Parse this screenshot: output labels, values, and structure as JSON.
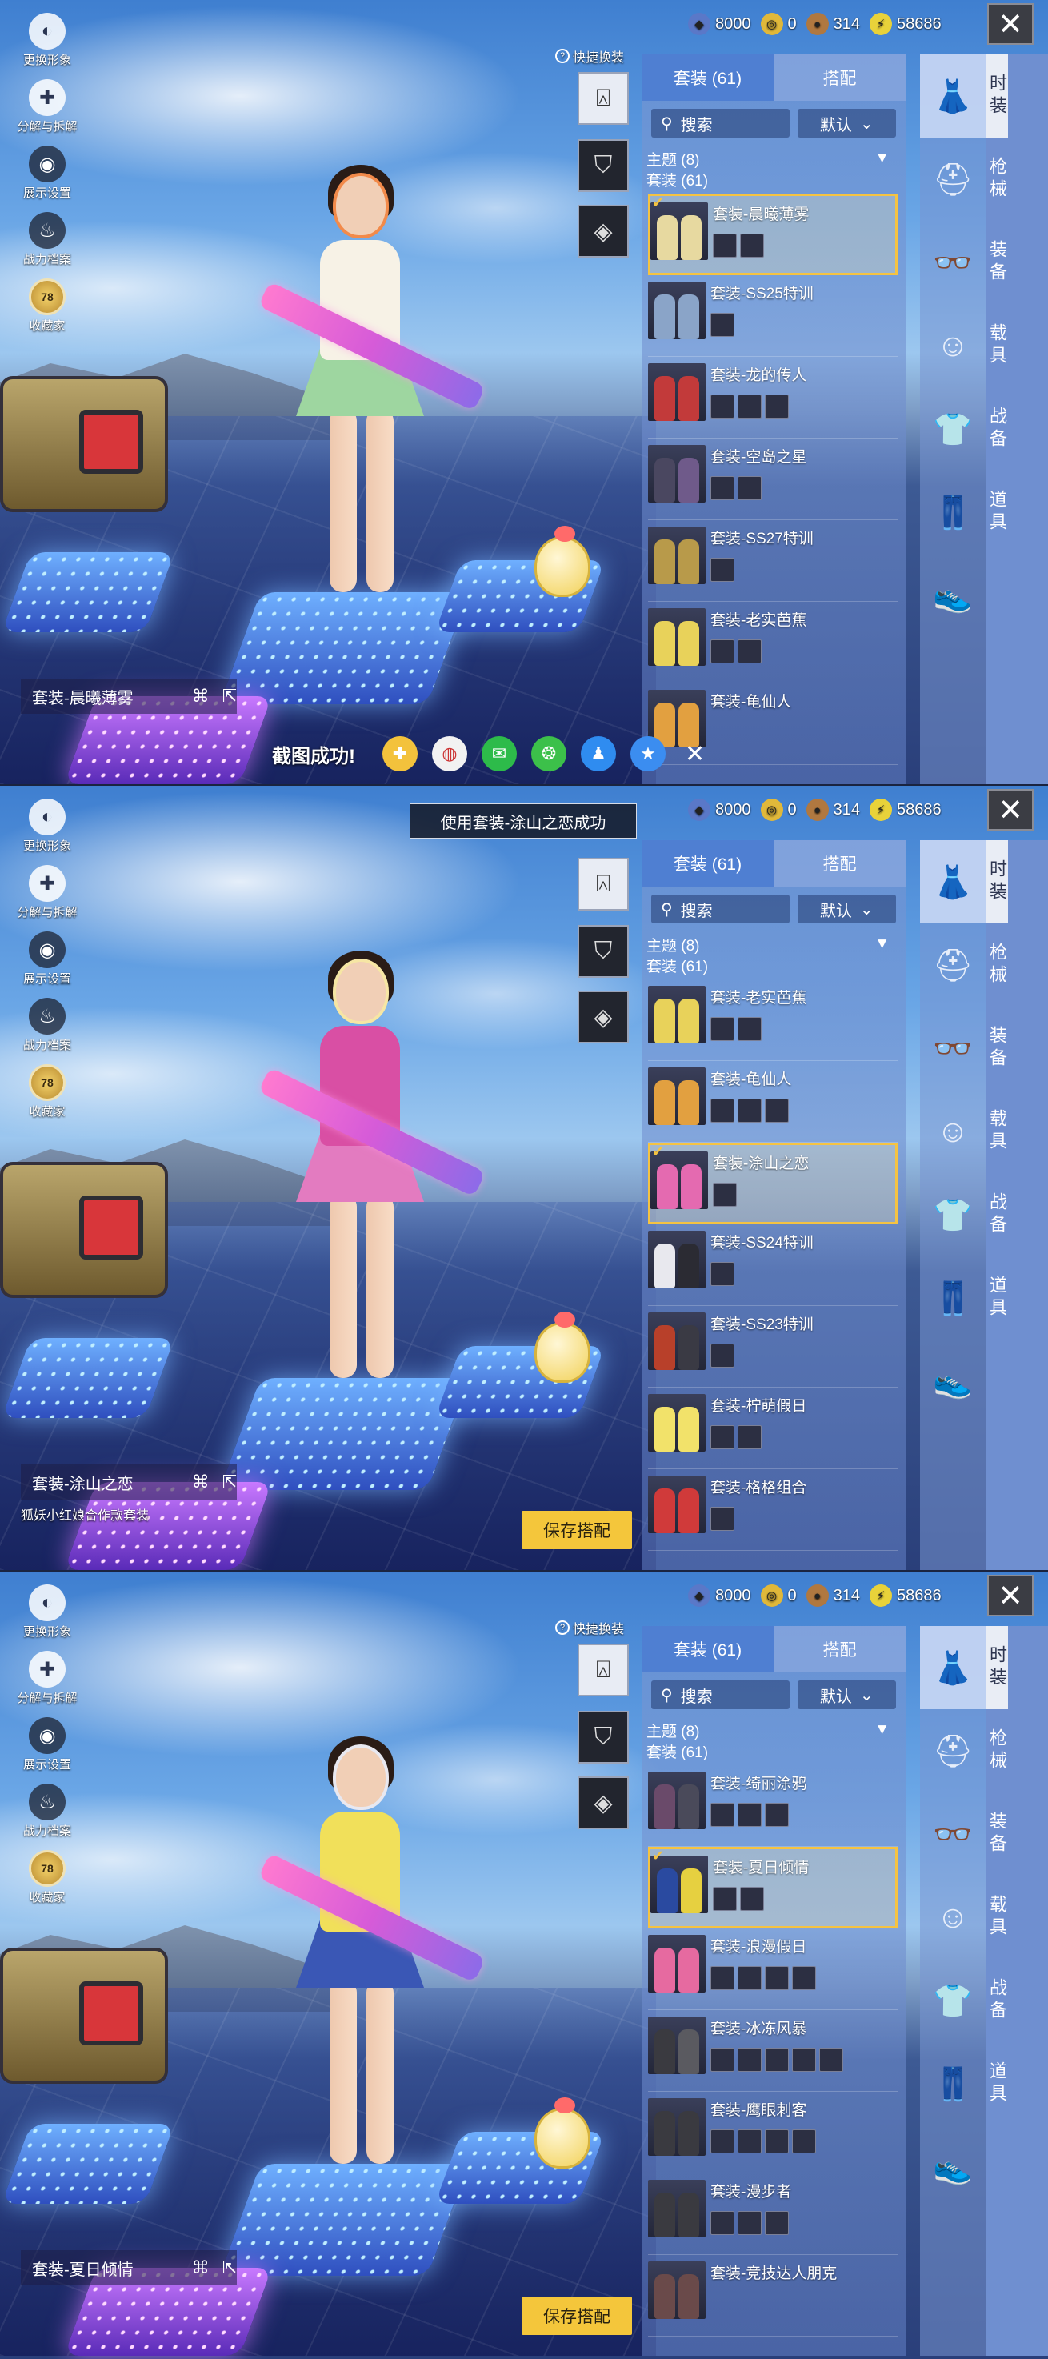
{
  "currency": [
    {
      "icon": "gem-icon",
      "value": "8000",
      "color": "#5a78c8"
    },
    {
      "icon": "coupon-icon",
      "value": "0",
      "color": "#e0b83a"
    },
    {
      "icon": "coin-icon",
      "value": "314",
      "color": "#b07840"
    },
    {
      "icon": "bp-icon",
      "value": "58686",
      "color": "#e8d23a"
    }
  ],
  "left_menu": [
    {
      "icon": "avatar-icon",
      "label": "更换形象"
    },
    {
      "icon": "puzzle-icon",
      "label": "分解与拆解"
    },
    {
      "icon": "eye-icon",
      "label": "展示设置"
    },
    {
      "icon": "flame-icon",
      "label": "战力档案"
    },
    {
      "icon": "collector-badge-icon",
      "label": "收藏家",
      "badge": "78"
    }
  ],
  "quick_swap": "快捷换装",
  "tabs": {
    "outfit": "套装 (61)",
    "match": "搭配"
  },
  "search_placeholder": "搜索",
  "sort_label": "默认",
  "theme_label": "主题 (8)",
  "group_label": "套装 (61)",
  "categories_vertical": [
    "时装",
    "枪械",
    "装备",
    "载具",
    "战备",
    "道具"
  ],
  "save_button": "保存搭配",
  "panels": [
    {
      "current_outfit": "套装-晨曦薄雾",
      "share": {
        "message": "截图成功!"
      },
      "outfits": [
        {
          "name": "套装-晨曦薄雾",
          "selected": true,
          "parts": 2,
          "colors": [
            "#e7d9a0",
            "#e7d9a0"
          ]
        },
        {
          "name": "套装-SS25特训",
          "selected": false,
          "parts": 1,
          "colors": [
            "#8aa4c8",
            "#8aa4c8"
          ]
        },
        {
          "name": "套装-龙的传人",
          "selected": false,
          "parts": 3,
          "colors": [
            "#c23a3a",
            "#c23a3a"
          ]
        },
        {
          "name": "套装-空岛之星",
          "selected": false,
          "parts": 2,
          "colors": [
            "#4a4760",
            "#6f5a8a"
          ]
        },
        {
          "name": "套装-SS27特训",
          "selected": false,
          "parts": 1,
          "colors": [
            "#b89a4a",
            "#b89a4a"
          ]
        },
        {
          "name": "套装-老实芭蕉",
          "selected": false,
          "parts": 2,
          "colors": [
            "#e8d25a",
            "#e8d25a"
          ]
        },
        {
          "name": "套装-龟仙人",
          "selected": false,
          "parts": 0,
          "colors": [
            "#e2a040",
            "#e2a040"
          ]
        }
      ]
    },
    {
      "current_outfit": "套装-涂山之恋",
      "toast": "使用套装-涂山之恋成功",
      "sub_note": "狐妖小红娘合作款套装",
      "outfits": [
        {
          "name": "套装-老实芭蕉",
          "selected": false,
          "parts": 2,
          "colors": [
            "#e8d25a",
            "#e8d25a"
          ]
        },
        {
          "name": "套装-龟仙人",
          "selected": false,
          "parts": 3,
          "colors": [
            "#e2a040",
            "#e2a040"
          ]
        },
        {
          "name": "套装-涂山之恋",
          "selected": true,
          "parts": 1,
          "colors": [
            "#e46ab0",
            "#e46ab0"
          ]
        },
        {
          "name": "套装-SS24特训",
          "selected": false,
          "parts": 1,
          "colors": [
            "#e8e8ee",
            "#2b2b33"
          ]
        },
        {
          "name": "套装-SS23特训",
          "selected": false,
          "parts": 1,
          "colors": [
            "#b8402a",
            "#3a3a44"
          ]
        },
        {
          "name": "套装-柠萌假日",
          "selected": false,
          "parts": 2,
          "colors": [
            "#f2e26a",
            "#f2e26a"
          ]
        },
        {
          "name": "套装-格格组合",
          "selected": false,
          "parts": 1,
          "colors": [
            "#d03a3a",
            "#d03a3a"
          ]
        }
      ]
    },
    {
      "current_outfit": "套装-夏日倾情",
      "outfits": [
        {
          "name": "套装-绮丽涂鸦",
          "selected": false,
          "parts": 3,
          "colors": [
            "#6a4a6a",
            "#4a4a5a"
          ]
        },
        {
          "name": "套装-夏日倾情",
          "selected": true,
          "parts": 2,
          "colors": [
            "#2a4aa0",
            "#e6d040"
          ]
        },
        {
          "name": "套装-浪漫假日",
          "selected": false,
          "parts": 4,
          "colors": [
            "#e66aa0",
            "#e66aa0"
          ]
        },
        {
          "name": "套装-冰冻风暴",
          "selected": false,
          "parts": 5,
          "colors": [
            "#3a3a40",
            "#5a5a60"
          ]
        },
        {
          "name": "套装-鹰眼刺客",
          "selected": false,
          "parts": 4,
          "colors": [
            "#3a3a40",
            "#3a3a40"
          ]
        },
        {
          "name": "套装-漫步者",
          "selected": false,
          "parts": 3,
          "colors": [
            "#3a3a40",
            "#3a3a40"
          ]
        },
        {
          "name": "套装-竞技达人朋克",
          "selected": false,
          "parts": 0,
          "colors": [
            "#6a4a4a",
            "#6a4a4a"
          ]
        }
      ]
    }
  ],
  "character_colors": [
    {
      "top": "#f7f2e6",
      "skirt": "#9ed6a0",
      "accent": "#f28a4a"
    },
    {
      "top": "#d94fa4",
      "skirt": "#e37bc0",
      "accent": "#f6e6a4"
    },
    {
      "top": "#f1e05a",
      "skirt": "#3a57b5",
      "accent": "#e8e8f0"
    }
  ]
}
